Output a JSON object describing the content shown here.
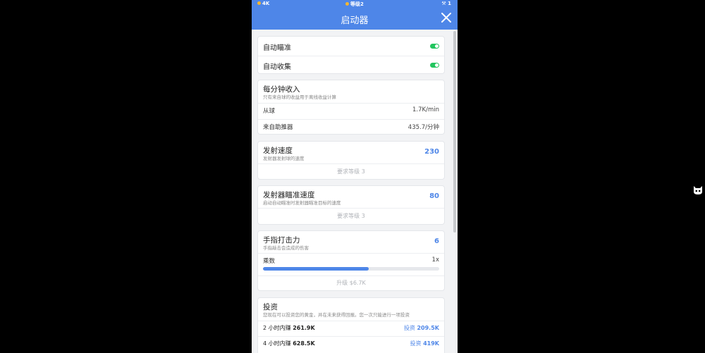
{
  "status_bar": {
    "left": "4K",
    "center": "等级2",
    "right": "1"
  },
  "header": {
    "title": "启动器"
  },
  "toggles": [
    {
      "label": "自动瞄准",
      "on": true
    },
    {
      "label": "自动收集",
      "on": true
    }
  ],
  "income": {
    "title": "每分钟收入",
    "subtitle": "只有来自球的收益用于离线收益计算",
    "rows": [
      {
        "label": "从球",
        "value": "1.7K/min"
      },
      {
        "label": "来自助推器",
        "value": "435.7/分钟"
      }
    ]
  },
  "launch_speed": {
    "title": "发射速度",
    "subtitle": "发射器发射球的速度",
    "value": "230",
    "requirement": "要求等级 3"
  },
  "aim_speed": {
    "title": "发射器瞄准速度",
    "subtitle": "启动自动瞄准时发射器瞄准目标的速度",
    "value": "80",
    "requirement": "要求等级 3"
  },
  "tap_power": {
    "title": "手指打击力",
    "subtitle": "手指敲击会造成的伤害",
    "value": "6",
    "multiplier_label": "乘数",
    "multiplier_value": "1x",
    "progress": 0.6,
    "upgrade_label": "升级 $6.7K"
  },
  "invest": {
    "title": "投资",
    "subtitle": "您现在可以投资您的黄金，并在未来获得回报。您一次只能进行一项投资",
    "options": [
      {
        "duration": "2 小时内赚",
        "earn": "261.9K",
        "action": "投资",
        "cost": "209.5K"
      },
      {
        "duration": "4 小时内赚",
        "earn": "628.5K",
        "action": "投资",
        "cost": "419K"
      }
    ]
  },
  "colors": {
    "accent": "#4e86e8",
    "toggle_on": "#22c55e",
    "background": "#000000"
  },
  "icons": {
    "close": "close-icon",
    "side": "cat-icon"
  }
}
